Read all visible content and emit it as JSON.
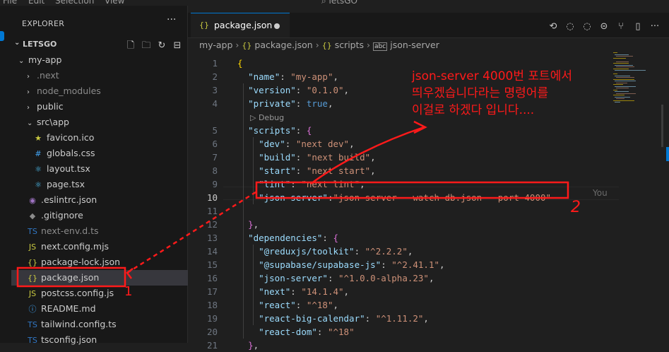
{
  "menubar": {
    "items": [
      "File",
      "Edit",
      "Selection",
      "View"
    ],
    "search": "letsGO"
  },
  "explorer": {
    "title": "EXPLORER",
    "more": "···",
    "root": "LETSGO",
    "tree": [
      {
        "label": "my-app",
        "kind": "folder-open",
        "depth": 1
      },
      {
        "label": ".next",
        "kind": "folder",
        "depth": 2,
        "dim": true
      },
      {
        "label": "node_modules",
        "kind": "folder",
        "depth": 2,
        "dim": true
      },
      {
        "label": "public",
        "kind": "folder",
        "depth": 2
      },
      {
        "label": "src\\app",
        "kind": "folder-open",
        "depth": 2
      },
      {
        "label": "favicon.ico",
        "kind": "file",
        "icon": "★",
        "iconColor": "#cbcb41",
        "depth": 3
      },
      {
        "label": "globals.css",
        "kind": "file",
        "icon": "#",
        "iconColor": "#42a5f5",
        "depth": 3
      },
      {
        "label": "layout.tsx",
        "kind": "file",
        "icon": "⚛",
        "iconColor": "#4fc3f7",
        "depth": 3
      },
      {
        "label": "page.tsx",
        "kind": "file",
        "icon": "⚛",
        "iconColor": "#4fc3f7",
        "depth": 3
      },
      {
        "label": ".eslintrc.json",
        "kind": "file",
        "icon": "◉",
        "iconColor": "#a074c4",
        "depth": 2
      },
      {
        "label": ".gitignore",
        "kind": "file",
        "icon": "◆",
        "iconColor": "#8b8b8b",
        "depth": 2
      },
      {
        "label": "next-env.d.ts",
        "kind": "file",
        "icon": "TS",
        "iconColor": "#3178c6",
        "depth": 2,
        "dim": true
      },
      {
        "label": "next.config.mjs",
        "kind": "file",
        "icon": "JS",
        "iconColor": "#cbcb41",
        "depth": 2
      },
      {
        "label": "package-lock.json",
        "kind": "file",
        "icon": "{}",
        "iconColor": "#cbcb41",
        "depth": 2
      },
      {
        "label": "package.json",
        "kind": "file",
        "icon": "{}",
        "iconColor": "#cbcb41",
        "depth": 2,
        "selected": true
      },
      {
        "label": "postcss.config.js",
        "kind": "file",
        "icon": "JS",
        "iconColor": "#cbcb41",
        "depth": 2
      },
      {
        "label": "README.md",
        "kind": "file",
        "icon": "ⓘ",
        "iconColor": "#42a5f5",
        "depth": 2
      },
      {
        "label": "tailwind.config.ts",
        "kind": "file",
        "icon": "TS",
        "iconColor": "#3178c6",
        "depth": 2
      },
      {
        "label": "tsconfig.json",
        "kind": "file",
        "icon": "TS",
        "iconColor": "#3178c6",
        "depth": 2
      }
    ]
  },
  "tab": {
    "label": "package.json",
    "icon": "{}"
  },
  "breadcrumb": [
    "my-app",
    "package.json",
    "scripts",
    "json-server"
  ],
  "breadcrumb_icons": [
    "{}",
    "{}",
    "abc"
  ],
  "editor": {
    "line_numbers": [
      "1",
      "2",
      "3",
      "4",
      "",
      "5",
      "6",
      "7",
      "8",
      "9",
      "10",
      "11",
      "12",
      "13",
      "14",
      "15",
      "16",
      "17",
      "18",
      "19",
      "20",
      "21"
    ],
    "active_line": "10",
    "codelens": "▷ Debug",
    "ghost": "You",
    "lines": [
      "{",
      "  \"name\": \"my-app\",",
      "  \"version\": \"0.1.0\",",
      "  \"private\": true,",
      "",
      "  \"scripts\": {",
      "    \"dev\": \"next dev\",",
      "    \"build\": \"next build\",",
      "    \"start\": \"next start\",",
      "    \"lint\": \"next lint\",",
      "    \"json-server\":\"json-server --watch db.json --port 4000\"",
      "",
      "  },",
      "  \"dependencies\": {",
      "    \"@reduxjs/toolkit\": \"^2.2.2\",",
      "    \"@supabase/supabase-js\": \"^2.41.1\",",
      "    \"json-server\": \"^1.0.0-alpha.23\",",
      "    \"next\": \"14.1.4\",",
      "    \"react\": \"^18\",",
      "    \"react-big-calendar\": \"^1.11.2\",",
      "    \"react-dom\": \"^18\"",
      "  },"
    ]
  },
  "annotation": {
    "lines": [
      "json-server 4000번 포트에서",
      "띄우겠습니다라는 명령어를",
      "이걸로 하겠다 입니다...."
    ],
    "marker1": "1",
    "marker2": "2",
    "color": "#ff1a1a"
  },
  "colors": {
    "accent": "#0078d4",
    "key": "#9cdcfe",
    "string": "#ce9178",
    "bracket": "#ffd700"
  }
}
